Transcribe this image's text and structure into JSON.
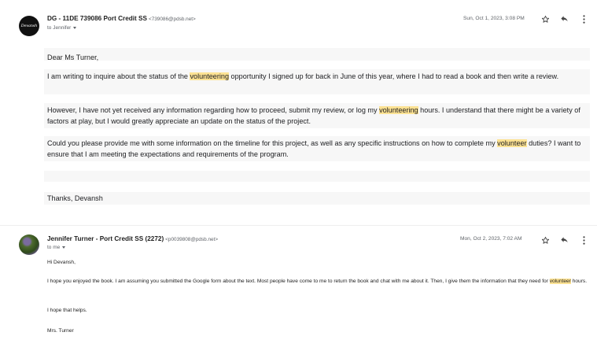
{
  "message1": {
    "avatar_text": "Devansh",
    "sender_name": "DG - 11DE 739086 Port Credit SS",
    "sender_email": "<739086@pdsb.net>",
    "to_label": "to Jennifer",
    "date": "Sun, Oct 1, 2023, 3:08 PM",
    "greeting": "Dear Ms Turner,",
    "p1": {
      "before": "I am writing to inquire about the status of the ",
      "highlight": "volunteering",
      "after": " opportunity I signed up for back in June of this year, where I had to read a book and then write a review."
    },
    "p2": {
      "before": "However, I have not yet received any information regarding how to proceed, submit my review, or log my ",
      "highlight": "volunteering",
      "after": " hours. I understand that there might be a variety of factors at play, but I would greatly appreciate an update on the status of the project."
    },
    "p3": {
      "before": "Could you please provide me with some information on the timeline for this project, as well as any specific instructions on how to complete my ",
      "highlight": "volunteer",
      "after": " duties? I want to ensure that I am meeting the expectations and requirements of the program."
    },
    "closing": "Thanks, Devansh"
  },
  "message2": {
    "sender_name": "Jennifer Turner - Port Credit SS (2272)",
    "sender_email": "<p0039808@pdsb.net>",
    "to_label": "to me",
    "date": "Mon, Oct 2, 2023, 7:02 AM",
    "greeting": "Hi Devansh,",
    "p1": {
      "before": "I hope you enjoyed the book.  I am assuming you submitted the Google form about the text.  Most people have come to me to return the book and chat with me about it.  Then, I give them the information that they need for ",
      "highlight": "volunteer",
      "after": " hours."
    },
    "p2": "I hope that helps.",
    "signoff": "Mrs. Turner"
  },
  "icons": {
    "star": "star-icon",
    "reply": "reply-icon",
    "more": "more-vert-icon"
  }
}
